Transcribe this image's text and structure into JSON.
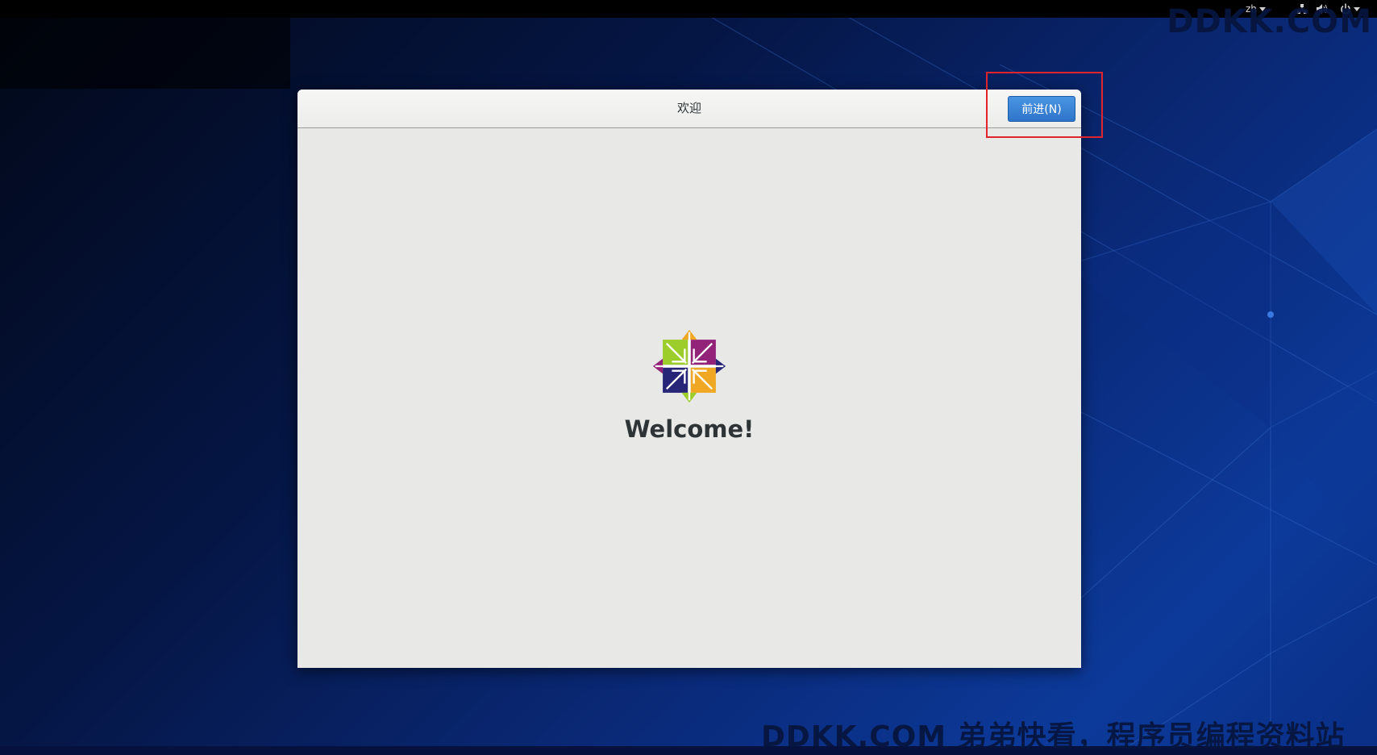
{
  "topbar": {
    "language": "zh",
    "icons": [
      "network-icon",
      "volume-icon",
      "power-icon"
    ]
  },
  "watermarks": {
    "top": "DDKK.COM",
    "bottom": "DDKK.COM 弟弟快看，程序员编程资料站"
  },
  "window": {
    "title": "欢迎",
    "next_button": "前进(N)",
    "welcome_text": "Welcome!"
  },
  "colors": {
    "accent_button": "#3580d8",
    "highlight_box": "#e0242e",
    "logo_green": "#9ccd2a",
    "logo_purple": "#932279",
    "logo_orange": "#efa724",
    "logo_navy": "#262577"
  }
}
